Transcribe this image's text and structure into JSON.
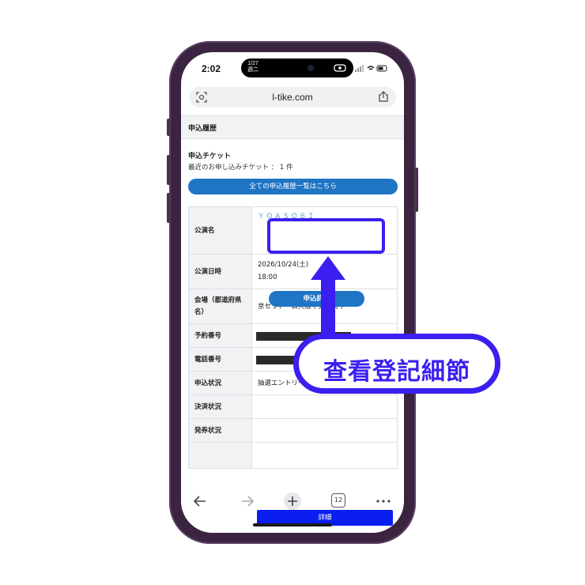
{
  "status_bar": {
    "time": "2:02",
    "island_date_line1": "1/27",
    "island_date_line2": "週二"
  },
  "browser": {
    "url": "l-tike.com"
  },
  "page": {
    "section_title": "申込履歴",
    "ticket_heading": "申込チケット",
    "recent_text": "最近のお申し込みチケット ： 1 件",
    "all_history_button": "全ての申込履歴一覧はこちら",
    "table": {
      "performance_label": "公演名",
      "performance_value": "ＹＯＡＳＯＢＩ",
      "apply_detail_button": "申込詳細",
      "date_label": "公演日時",
      "date_value": "2026/10/24(土)",
      "time_value": "18:00",
      "venue_label_line1": "会場（都道府県",
      "venue_label_line2": "名）",
      "venue_value": "京セラドーム大阪 ( 大阪府 )",
      "reservation_label": "予約番号",
      "phone_label": "電話番号",
      "status_label": "申込状況",
      "status_value": "抽選エントリー",
      "payment_label": "決済状況",
      "issue_label": "発券状況",
      "detail_button": "詳細"
    }
  },
  "toolbar": {
    "tab_count": "12"
  },
  "annotation": {
    "callout_text": "查看登記細節",
    "accent_color": "#3b1ff0"
  },
  "colors": {
    "frame": "#3a2440",
    "button_blue": "#1f74c4",
    "detail_button_blue": "#0a1ef0"
  }
}
